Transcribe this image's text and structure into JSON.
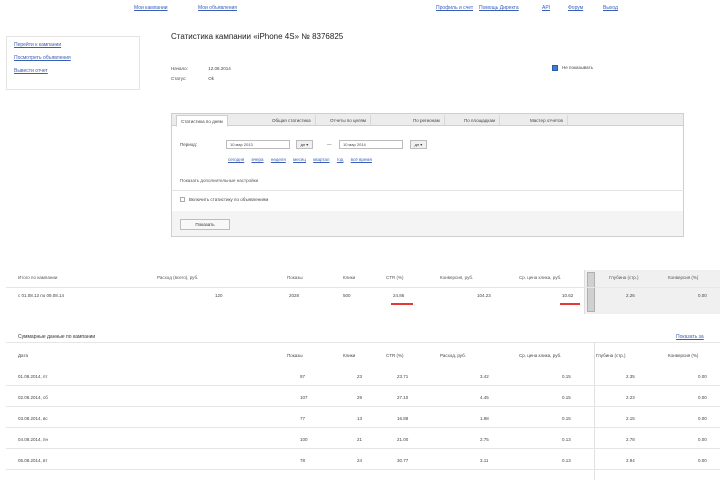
{
  "topnav": {
    "left": [
      "Мои кампании",
      "Мои объявления"
    ],
    "right": [
      "Профиль и счет",
      "Помощь Директа",
      "API",
      "Форум",
      "Выход"
    ]
  },
  "sidebar": {
    "items": [
      "Перейти к кампании",
      "Посмотреть объявления",
      "Вывести отчет"
    ]
  },
  "page": {
    "title": "Статистика кампании «iPhone 4S» № 8376825",
    "created_label": "Начало:",
    "created_value": "12.08.2014",
    "status_label": "Статус:",
    "status_value": "Ok",
    "checkbox_label": "Не показывать"
  },
  "panel": {
    "tabs": [
      "Статистика по дням",
      "Общая статистика",
      "Отчеты по целям",
      "По регионам",
      "По площадкам",
      "Мастер отчетов"
    ],
    "period_label": "Период:",
    "date_from": "10 мар 2013",
    "date_to": "10 мар 2014",
    "date_btn": "дн ▾",
    "date_sep": "—",
    "presets": [
      "сегодня",
      "вчера",
      "неделя",
      "месяц",
      "квартал",
      "год",
      "всё время"
    ],
    "extra_link": "Показать дополнительные настройки",
    "option_label": "Включить статистику по объявлениям",
    "show_button": "Показать"
  },
  "summary": {
    "headers": [
      "Итого по кампании",
      "Расход (всего), руб.",
      "Показы",
      "Клики",
      "CTR (%)",
      "Конверсия, руб.",
      "Ср. цена клика, руб.",
      "Глубина (стр.)",
      "Конверсия (%)"
    ],
    "row": [
      "с 01.08.13 по 09.08.14",
      "120",
      "2028",
      "500",
      "24.86",
      "104.23",
      "10.62",
      "2.26",
      "0.00"
    ]
  },
  "details": {
    "title": "Суммарные данные по кампании",
    "link": "Показать за",
    "headers": [
      "Дата",
      "Показы",
      "Клики",
      "CTR (%)",
      "Расход, руб.",
      "Ср. цена клика, руб.",
      "Глубина (стр.)",
      "Конверсия (%)"
    ],
    "rows": [
      [
        "01.08.2014, пт",
        "97",
        "23",
        "23.71",
        "3.42",
        "0.15",
        "2.35",
        "0.00"
      ],
      [
        "02.08.2014, сб",
        "107",
        "29",
        "27.10",
        "4.45",
        "0.15",
        "2.23",
        "0.00"
      ],
      [
        "03.08.2014, вс",
        "77",
        "13",
        "16.88",
        "1.98",
        "0.15",
        "2.15",
        "0.00"
      ],
      [
        "04.08.2014, пн",
        "100",
        "21",
        "21.00",
        "2.75",
        "0.13",
        "2.78",
        "0.00"
      ],
      [
        "05.08.2014, вт",
        "78",
        "24",
        "30.77",
        "3.11",
        "0.13",
        "2.94",
        "0.00"
      ]
    ]
  },
  "colors": {
    "link": "#3a5fb8",
    "accent_underline": "#e53935",
    "checkbox": "#3a7bd5"
  }
}
